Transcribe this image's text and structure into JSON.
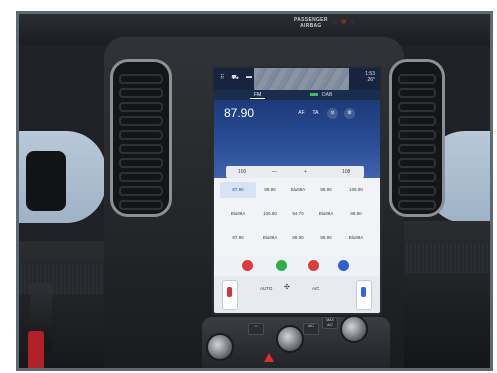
{
  "dashboard": {
    "airbag_label_line1": "PASSENGER",
    "airbag_label_line2": "AIRBAG"
  },
  "screen": {
    "top_bar": {
      "icons": [
        "apps-icon",
        "car-icon",
        "battery-icon"
      ],
      "time": "1:53",
      "temperature": "26°"
    },
    "tabs": {
      "fm": "FM",
      "dab": "DAB"
    },
    "radio": {
      "frequency": "87.90",
      "buttons": [
        "AF",
        "TA"
      ]
    },
    "seek_bar": {
      "left": "100",
      "minus": "—",
      "plus": "+",
      "right": "108"
    },
    "preset_rows": [
      [
        "87.90",
        "88.90",
        "Blu99A",
        "98.90",
        "106.90"
      ],
      [
        "Blu99A",
        "106.90",
        "94.70",
        "Blu99A",
        "88.90"
      ],
      [
        "87.90",
        "Blu99A",
        "88.90",
        "98.90",
        "Blu99A"
      ]
    ],
    "apps": [
      {
        "name": "radio-app-icon",
        "color": "#e0393e"
      },
      {
        "name": "phone-app-icon",
        "color": "#2fae4e"
      },
      {
        "name": "music-app-icon",
        "color": "#e0393e"
      },
      {
        "name": "settings-app-icon",
        "color": "#2e62d1"
      }
    ],
    "climate": {
      "left_label": "AUTO",
      "center_label": "A/C"
    }
  },
  "controls": {
    "buttons": [
      "A/C",
      "MAX A/C"
    ]
  }
}
